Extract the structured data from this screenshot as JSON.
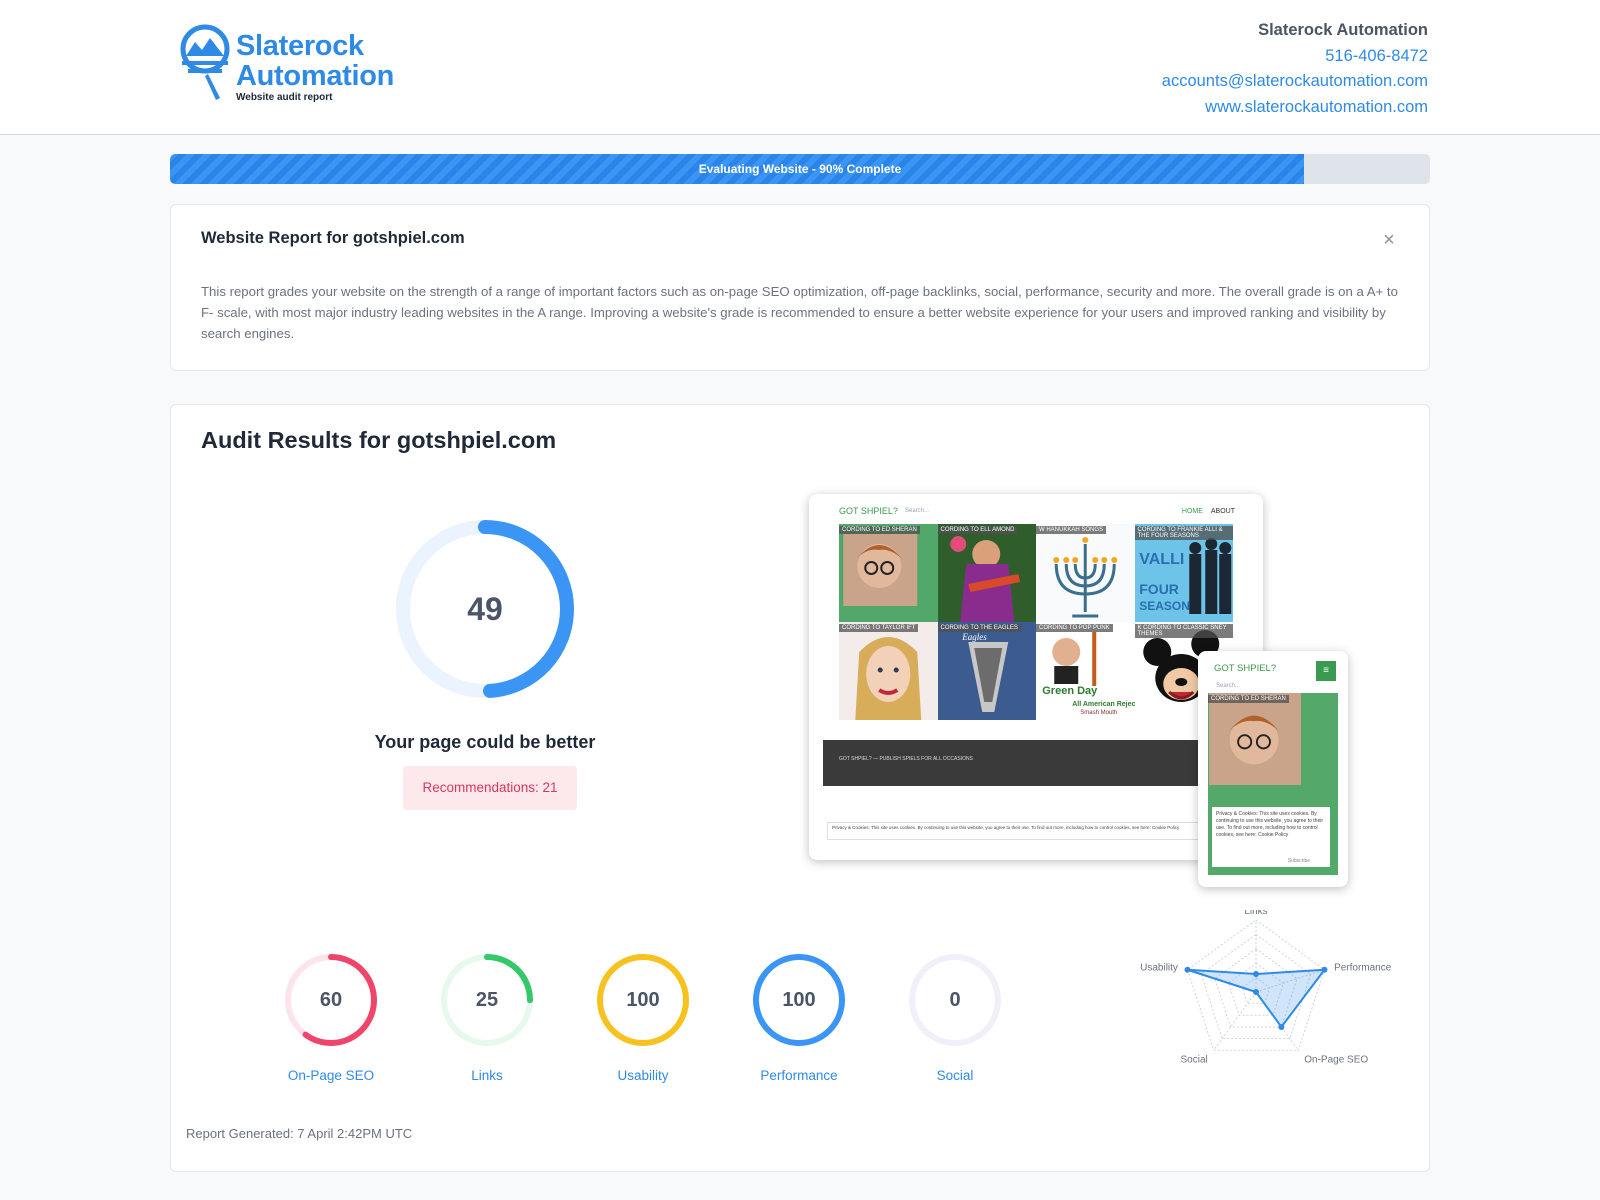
{
  "header": {
    "logo_line1": "Slaterock",
    "logo_line2": "Automation",
    "logo_sub": "Website audit report",
    "company": "Slaterock Automation",
    "phone": "516-406-8472",
    "email": "accounts@slaterockautomation.com",
    "website": "www.slaterockautomation.com"
  },
  "progress": {
    "label": "Evaluating Website - 90% Complete",
    "percent": 90,
    "color": "#2f8ae6"
  },
  "intro": {
    "title": "Website Report for gotshpiel.com",
    "close_icon": "close-icon",
    "text": "This report grades your website on the strength of a range of important factors such as on-page SEO optimization, off-page backlinks, social, performance, security and more. The overall grade is on a A+ to F- scale, with most major industry leading websites in the A range. Improving a website's grade is recommended to ensure a better website experience for your users and improved ranking and visibility by search engines."
  },
  "audit": {
    "title": "Audit Results for gotshpiel.com",
    "overall_score": 49,
    "overall_color": "#3b95f5",
    "verdict": "Your page could be better",
    "recommendations": "Recommendations: 21",
    "generated": "Report Generated: 7 April 2:42PM UTC"
  },
  "preview": {
    "site_name": "GOT SHPIEL?",
    "search_placeholder": "Search...",
    "menu": [
      "HOME",
      "ABOUT"
    ],
    "tile_captions": [
      "CORDING TO ED SHERAN",
      "CORDING TO ELL AMOND",
      "W HANUKKAH SONGS",
      "CORDING TO FRANKIE ALLI & THE FOUR SEASONS",
      "CORDING TO TAYLOR IFT",
      "CORDING TO THE EAGLES",
      "CORDING TO POP PUNK",
      "K CORDING TO CLASSIC SNEY THEMES"
    ],
    "footer_text": "GOT SHPIEL? — PUBLISH SPIELS FOR ALL OCCASIONS",
    "cookie_text": "Privacy & Cookies: This site uses cookies. By continuing to use this website, you agree to their use. To find out more, including how to control cookies, see here: Cookie Policy",
    "mobile_caption": "CORDING TO ED SHERAN",
    "mobile_cookie": "Privacy & Cookies: This site uses cookies. By continuing to use this website, you agree to their use. To find out more, including how to control cookies, see here: Cookie Policy",
    "mobile_subscribe": "Subscribe"
  },
  "scores": [
    {
      "label": "On-Page SEO",
      "value": 60,
      "color": "#f0456b",
      "track": "#fde4ea"
    },
    {
      "label": "Links",
      "value": 25,
      "color": "#34c86b",
      "track": "#e6f9ec"
    },
    {
      "label": "Usability",
      "value": 100,
      "color": "#f7c21f",
      "track": "#fdf4d4"
    },
    {
      "label": "Performance",
      "value": 100,
      "color": "#3b95f5",
      "track": "#e3f0fd"
    },
    {
      "label": "Social",
      "value": 0,
      "color": "#a78bfa",
      "track": "#f1effa"
    }
  ],
  "radar": {
    "axes": [
      "Links",
      "Performance",
      "On-Page SEO",
      "Social",
      "Usability"
    ],
    "values": [
      25,
      100,
      60,
      0,
      100
    ],
    "max": 100,
    "color": "#2f8ae6"
  }
}
